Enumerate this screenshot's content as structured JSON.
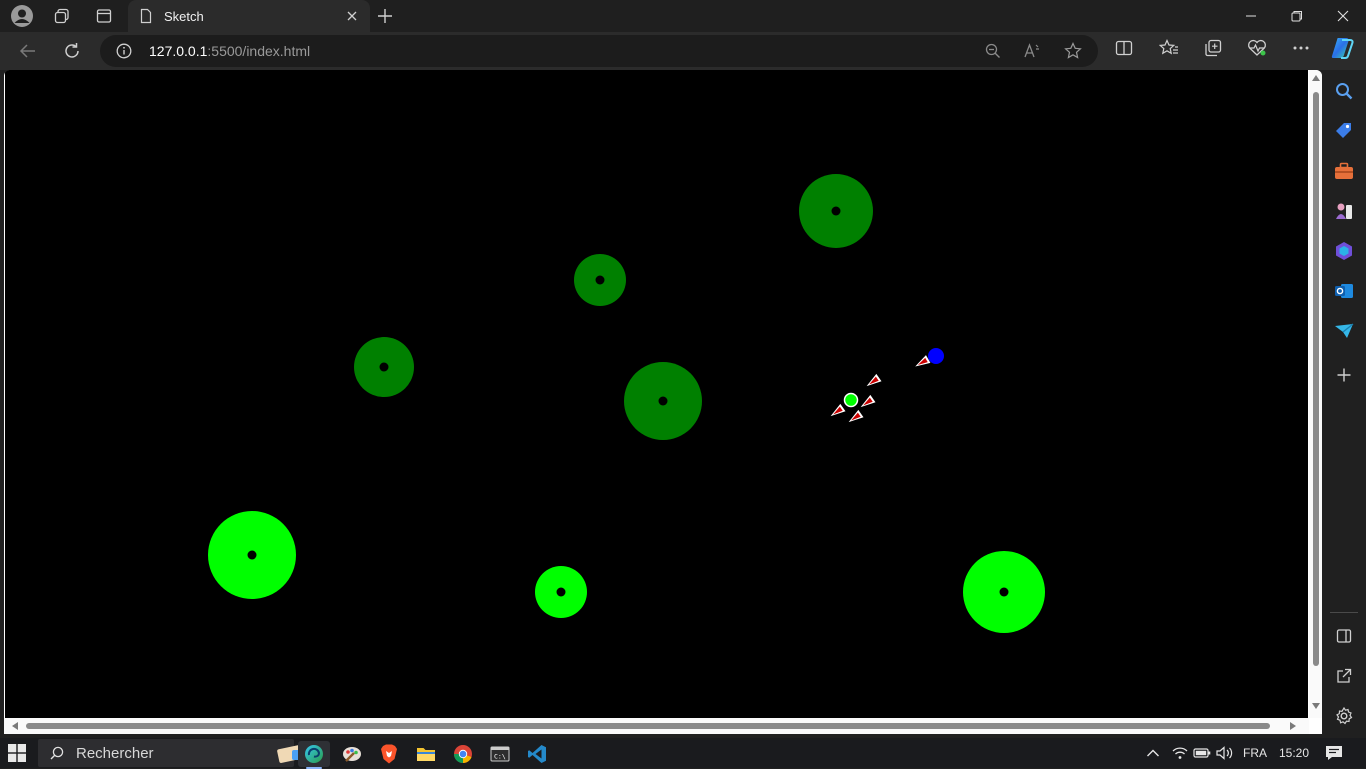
{
  "browser": {
    "tab_title": "Sketch",
    "address": {
      "host": "127.0.0.1",
      "rest": ":5500/index.html"
    }
  },
  "icons": {
    "titlebar": [
      "profile-avatar-icon",
      "tab-actions-icon",
      "vertical-tabs-icon",
      "page-icon",
      "close-tab-icon",
      "new-tab-icon",
      "minimize-icon",
      "restore-icon",
      "close-window-icon"
    ],
    "toolbar": [
      "back-arrow-icon",
      "refresh-icon",
      "info-icon",
      "zoom-out-icon",
      "read-aloud-icon",
      "favorite-star-icon",
      "split-screen-icon",
      "favorites-icon",
      "collections-icon",
      "browser-essentials-icon",
      "more-icon",
      "copilot-icon"
    ],
    "sidebar": [
      "search-icon",
      "shopping-tag-icon",
      "tools-icon",
      "games-icon",
      "microsoft-365-icon",
      "outlook-icon",
      "drop-icon",
      "add-icon",
      "hide-sidebar-icon",
      "external-link-icon",
      "settings-icon"
    ]
  },
  "colors": {
    "canvas_bg": "#000000",
    "dark_green": "#008000",
    "bright_green": "#00ff00",
    "blue": "#0000ff",
    "arrow_red": "#cc0000",
    "arrow_white": "#ffffff"
  },
  "taskbar": {
    "search_placeholder": "Rechercher",
    "apps": [
      "edge-icon",
      "paint-icon",
      "brave-icon",
      "file-explorer-icon",
      "chrome-icon",
      "terminal-icon",
      "vscode-icon"
    ],
    "language": "FRA",
    "time": "15:20"
  }
}
